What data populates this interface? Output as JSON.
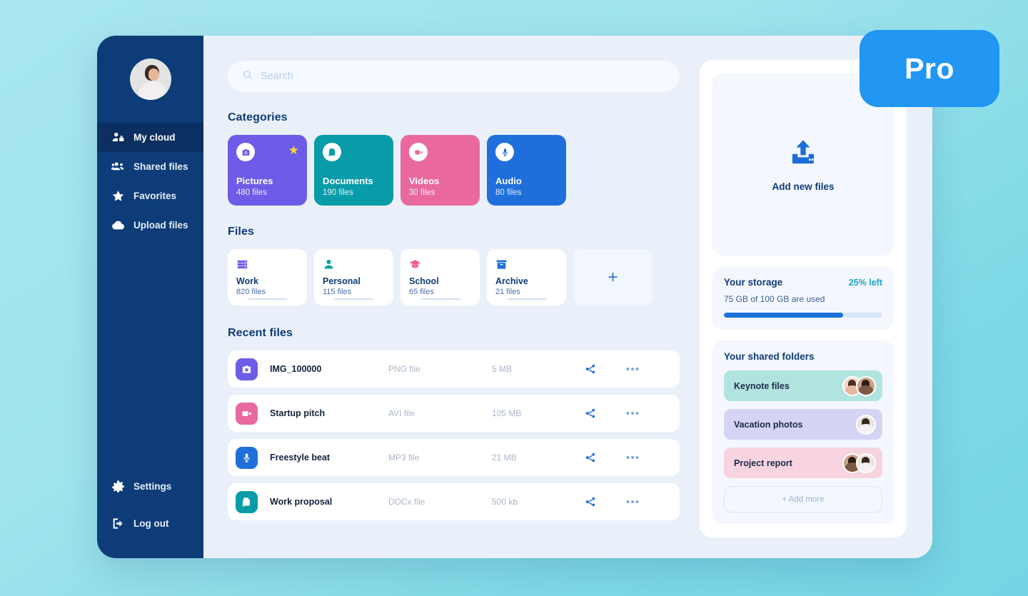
{
  "sidebar": {
    "avatar_name": "user-avatar",
    "items": [
      {
        "label": "My cloud",
        "icon": "user-lock-icon",
        "active": true
      },
      {
        "label": "Shared files",
        "icon": "users-icon",
        "active": false
      },
      {
        "label": "Favorites",
        "icon": "star-icon",
        "active": false
      },
      {
        "label": "Upload files",
        "icon": "cloud-upload-icon",
        "active": false
      }
    ],
    "bottom_items": [
      {
        "label": "Settings",
        "icon": "gear-icon"
      },
      {
        "label": "Log out",
        "icon": "logout-icon"
      }
    ]
  },
  "search": {
    "placeholder": "Search",
    "value": "",
    "icon": "search-icon"
  },
  "categories": {
    "title": "Categories",
    "items": [
      {
        "name": "Pictures",
        "count": "480 files",
        "color": "#6c5ce7",
        "icon": "camera-icon",
        "icon_color": "#6c5ce7",
        "starred": true,
        "star": "★"
      },
      {
        "name": "Documents",
        "count": "190 files",
        "color": "#089ca8",
        "icon": "documents-icon",
        "icon_color": "#089ca8",
        "starred": false,
        "star": ""
      },
      {
        "name": "Videos",
        "count": "30 files",
        "color": "#e9699f",
        "icon": "video-icon",
        "icon_color": "#e9699f",
        "starred": false,
        "star": ""
      },
      {
        "name": "Audio",
        "count": "80 files",
        "color": "#1f6fdb",
        "icon": "microphone-icon",
        "icon_color": "#1f6fdb",
        "starred": false,
        "star": ""
      }
    ]
  },
  "files": {
    "title": "Files",
    "add_label": "+",
    "items": [
      {
        "name": "Work",
        "count": "820 files",
        "icon": "server-icon",
        "icon_color": "#6c5ce7"
      },
      {
        "name": "Personal",
        "count": "115 files",
        "icon": "person-icon",
        "icon_color": "#0fa3a8"
      },
      {
        "name": "School",
        "count": "65 files",
        "icon": "graduation-cap-icon",
        "icon_color": "#ef5f92"
      },
      {
        "name": "Archive",
        "count": "21 files",
        "icon": "archive-box-icon",
        "icon_color": "#1f6fdb"
      }
    ]
  },
  "recent": {
    "title": "Recent files",
    "rows": [
      {
        "name": "IMG_100000",
        "type": "PNG file",
        "size": "5 MB",
        "icon": "camera-icon",
        "icon_color": "#6c5ce7",
        "share_icon": "share-icon",
        "more_icon": "more-options-icon",
        "more": "•••"
      },
      {
        "name": "Startup pitch",
        "type": "AVI file",
        "size": "105 MB",
        "icon": "video-icon",
        "icon_color": "#e9699f",
        "share_icon": "share-icon",
        "more_icon": "more-options-icon",
        "more": "•••"
      },
      {
        "name": "Freestyle beat",
        "type": "MP3 file",
        "size": "21 MB",
        "icon": "microphone-icon",
        "icon_color": "#1f6fdb",
        "share_icon": "share-icon",
        "more_icon": "more-options-icon",
        "more": "•••"
      },
      {
        "name": "Work proposal",
        "type": "DOCx file",
        "size": "500 kb",
        "icon": "documents-icon",
        "icon_color": "#089ca8",
        "share_icon": "share-icon",
        "more_icon": "more-options-icon",
        "more": "•••"
      }
    ]
  },
  "upload": {
    "label": "Add new files",
    "icon": "upload-icon"
  },
  "storage": {
    "title": "Your storage",
    "left_label": "25% left",
    "detail": "75 GB of 100 GB are used",
    "used_percent": 75
  },
  "shared": {
    "title": "Your shared folders",
    "add_more_label": "+ Add more",
    "folders": [
      {
        "name": "Keynote files",
        "color": "#b2e4df",
        "avatars": 2
      },
      {
        "name": "Vacation photos",
        "color": "#d6d4f5",
        "avatars": 1
      },
      {
        "name": "Project report",
        "color": "#f7d4e0",
        "avatars": 2
      }
    ]
  },
  "pro_badge": {
    "label": "Pro",
    "color": "#2196f3"
  }
}
